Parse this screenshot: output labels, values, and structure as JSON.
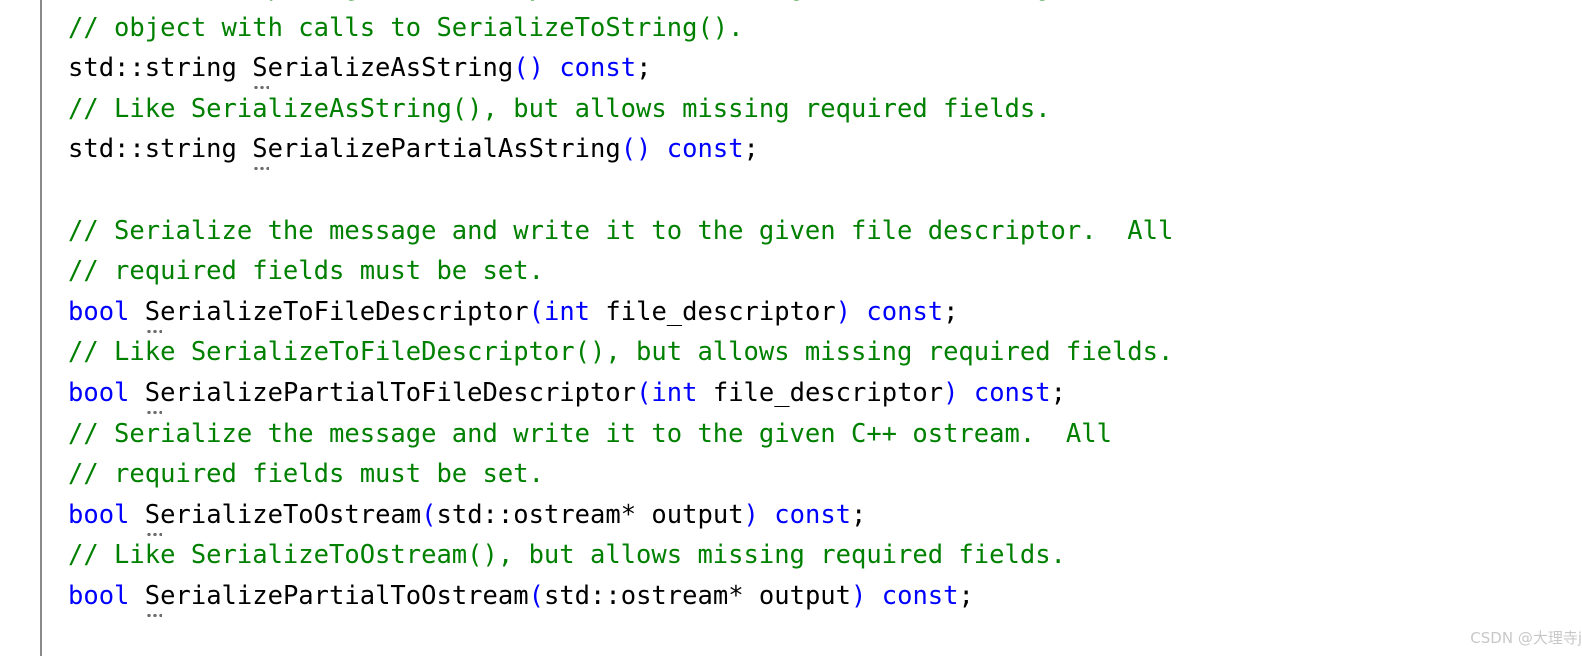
{
  "editor": {
    "type": "code-editor",
    "language": "C++",
    "background_color": "#ffffff",
    "indent_guide_color": "#8a8a8a",
    "colors": {
      "comment": "#008000",
      "keyword": "#0000ff",
      "plain": "#000000",
      "punctuation_highlight": "#0000ff",
      "hint_marker": "#6e6e6e",
      "watermark": "#c8c8c8"
    }
  },
  "lines": [
    {
      "id": "line-1",
      "clipped": true,
      "text": "// reduce heap fragmentation by instead re-using the same string",
      "tokens": [
        {
          "t": "// reduce heap fragmentation by instead re-using the same string",
          "c": "comment"
        }
      ]
    },
    {
      "id": "line-2",
      "text": "// object with calls to SerializeToString().",
      "tokens": [
        {
          "t": "// object with calls to SerializeToString().",
          "c": "comment"
        }
      ]
    },
    {
      "id": "line-3",
      "text": "std::string SerializeAsString() const;",
      "tokens": [
        {
          "t": "std::string ",
          "c": "plain"
        },
        {
          "t": "S",
          "c": "plain",
          "hint": true
        },
        {
          "t": "erializeAsString",
          "c": "plain"
        },
        {
          "t": "()",
          "c": "punct-blue"
        },
        {
          "t": " ",
          "c": "plain"
        },
        {
          "t": "const",
          "c": "keyword"
        },
        {
          "t": ";",
          "c": "plain"
        }
      ]
    },
    {
      "id": "line-4",
      "text": "// Like SerializeAsString(), but allows missing required fields.",
      "tokens": [
        {
          "t": "// Like SerializeAsString(), but allows missing required fields.",
          "c": "comment"
        }
      ]
    },
    {
      "id": "line-5",
      "text": "std::string SerializePartialAsString() const;",
      "tokens": [
        {
          "t": "std::string ",
          "c": "plain"
        },
        {
          "t": "S",
          "c": "plain",
          "hint": true
        },
        {
          "t": "erializePartialAsString",
          "c": "plain"
        },
        {
          "t": "()",
          "c": "punct-blue"
        },
        {
          "t": " ",
          "c": "plain"
        },
        {
          "t": "const",
          "c": "keyword"
        },
        {
          "t": ";",
          "c": "plain"
        }
      ]
    },
    {
      "id": "line-6",
      "text": "",
      "tokens": []
    },
    {
      "id": "line-7",
      "text": "// Serialize the message and write it to the given file descriptor.  All",
      "tokens": [
        {
          "t": "// Serialize the message and write it to the given file descriptor.  All",
          "c": "comment"
        }
      ]
    },
    {
      "id": "line-8",
      "text": "// required fields must be set.",
      "tokens": [
        {
          "t": "// required fields must be set.",
          "c": "comment"
        }
      ]
    },
    {
      "id": "line-9",
      "text": "bool SerializeToFileDescriptor(int file_descriptor) const;",
      "tokens": [
        {
          "t": "bool",
          "c": "keyword"
        },
        {
          "t": " ",
          "c": "plain"
        },
        {
          "t": "S",
          "c": "plain",
          "hint": true
        },
        {
          "t": "erializeToFileDescriptor",
          "c": "plain"
        },
        {
          "t": "(",
          "c": "punct-blue"
        },
        {
          "t": "int",
          "c": "keyword"
        },
        {
          "t": " file_descriptor",
          "c": "plain"
        },
        {
          "t": ")",
          "c": "punct-blue"
        },
        {
          "t": " ",
          "c": "plain"
        },
        {
          "t": "const",
          "c": "keyword"
        },
        {
          "t": ";",
          "c": "plain"
        }
      ]
    },
    {
      "id": "line-10",
      "text": "// Like SerializeToFileDescriptor(), but allows missing required fields.",
      "tokens": [
        {
          "t": "// Like SerializeToFileDescriptor(), but allows missing required fields.",
          "c": "comment"
        }
      ]
    },
    {
      "id": "line-11",
      "text": "bool SerializePartialToFileDescriptor(int file_descriptor) const;",
      "tokens": [
        {
          "t": "bool",
          "c": "keyword"
        },
        {
          "t": " ",
          "c": "plain"
        },
        {
          "t": "S",
          "c": "plain",
          "hint": true
        },
        {
          "t": "erializePartialToFileDescriptor",
          "c": "plain"
        },
        {
          "t": "(",
          "c": "punct-blue"
        },
        {
          "t": "int",
          "c": "keyword"
        },
        {
          "t": " file_descriptor",
          "c": "plain"
        },
        {
          "t": ")",
          "c": "punct-blue"
        },
        {
          "t": " ",
          "c": "plain"
        },
        {
          "t": "const",
          "c": "keyword"
        },
        {
          "t": ";",
          "c": "plain"
        }
      ]
    },
    {
      "id": "line-12",
      "text": "// Serialize the message and write it to the given C++ ostream.  All",
      "tokens": [
        {
          "t": "// Serialize the message and write it to the given C++ ostream.  All",
          "c": "comment"
        }
      ]
    },
    {
      "id": "line-13",
      "text": "// required fields must be set.",
      "tokens": [
        {
          "t": "// required fields must be set.",
          "c": "comment"
        }
      ]
    },
    {
      "id": "line-14",
      "text": "bool SerializeToOstream(std::ostream* output) const;",
      "tokens": [
        {
          "t": "bool",
          "c": "keyword"
        },
        {
          "t": " ",
          "c": "plain"
        },
        {
          "t": "S",
          "c": "plain",
          "hint": true
        },
        {
          "t": "erializeToOstream",
          "c": "plain"
        },
        {
          "t": "(",
          "c": "punct-blue"
        },
        {
          "t": "std::ostream* output",
          "c": "plain"
        },
        {
          "t": ")",
          "c": "punct-blue"
        },
        {
          "t": " ",
          "c": "plain"
        },
        {
          "t": "const",
          "c": "keyword"
        },
        {
          "t": ";",
          "c": "plain"
        }
      ]
    },
    {
      "id": "line-15",
      "text": "// Like SerializeToOstream(), but allows missing required fields.",
      "tokens": [
        {
          "t": "// Like SerializeToOstream(), but allows missing required fields.",
          "c": "comment"
        }
      ]
    },
    {
      "id": "line-16",
      "text": "bool SerializePartialToOstream(std::ostream* output) const;",
      "tokens": [
        {
          "t": "bool",
          "c": "keyword"
        },
        {
          "t": " ",
          "c": "plain"
        },
        {
          "t": "S",
          "c": "plain",
          "hint": true
        },
        {
          "t": "erializePartialToOstream",
          "c": "plain"
        },
        {
          "t": "(",
          "c": "punct-blue"
        },
        {
          "t": "std::ostream* output",
          "c": "plain"
        },
        {
          "t": ")",
          "c": "punct-blue"
        },
        {
          "t": " ",
          "c": "plain"
        },
        {
          "t": "const",
          "c": "keyword"
        },
        {
          "t": ";",
          "c": "plain"
        }
      ]
    }
  ],
  "watermark": {
    "text": "CSDN @大理寺j"
  }
}
